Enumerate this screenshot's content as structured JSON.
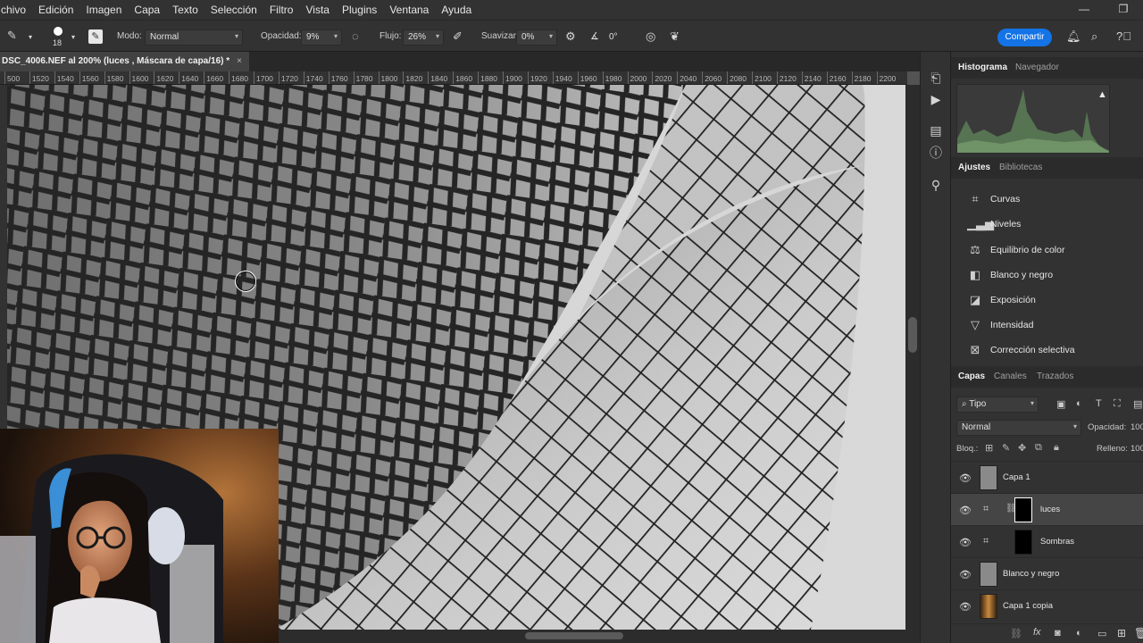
{
  "menu": [
    "chivo",
    "Edición",
    "Imagen",
    "Capa",
    "Texto",
    "Selección",
    "Filtro",
    "Vista",
    "Plugins",
    "Ventana",
    "Ayuda"
  ],
  "options": {
    "brush_size": "18",
    "mode_label": "Modo:",
    "mode_value": "Normal",
    "opacity_label": "Opacidad:",
    "opacity_value": "9%",
    "flow_label": "Flujo:",
    "flow_value": "26%",
    "smooth_label": "Suavizar:",
    "smooth_value": "0%",
    "angle_value": "0°",
    "share_label": "Compartir"
  },
  "document": {
    "tab_title": "DSC_4006.NEF al 200% (luces , Máscara de capa/16) *",
    "close_glyph": "×"
  },
  "ruler_ticks": [
    "500",
    "1520",
    "1540",
    "1560",
    "1580",
    "1600",
    "1620",
    "1640",
    "1660",
    "1680",
    "1700",
    "1720",
    "1740",
    "1760",
    "1780",
    "1800",
    "1820",
    "1840",
    "1860",
    "1880",
    "1900",
    "1920",
    "1940",
    "1960",
    "1980",
    "2000",
    "2020",
    "2040",
    "2060",
    "2080",
    "2100",
    "2120",
    "2140",
    "2160",
    "2180",
    "2200"
  ],
  "panels": {
    "top_tabs": [
      "Histograma",
      "Navegador"
    ],
    "adjust_tabs": [
      "Ajustes",
      "Bibliotecas"
    ],
    "adjustments": [
      {
        "icon": "curves-icon",
        "label": "Curvas"
      },
      {
        "icon": "levels-icon",
        "label": "Niveles"
      },
      {
        "icon": "color-balance-icon",
        "label": "Equilibrio de color"
      },
      {
        "icon": "black-white-icon",
        "label": "Blanco y negro"
      },
      {
        "icon": "exposure-icon",
        "label": "Exposición"
      },
      {
        "icon": "vibrance-icon",
        "label": "Intensidad"
      },
      {
        "icon": "selective-color-icon",
        "label": "Corrección selectiva"
      }
    ],
    "layer_tabs": [
      "Capas",
      "Canales",
      "Trazados"
    ],
    "filter_kind": "Tipo",
    "blend_mode": "Normal",
    "opacity_label": "Opacidad:",
    "opacity_value": "100",
    "lock_label": "Bloq.:",
    "fill_label": "Relleno:",
    "fill_value": "100"
  },
  "layers": [
    {
      "name": "Capa 1",
      "type": "pixel",
      "selected": false
    },
    {
      "name": "luces",
      "type": "adjustment",
      "selected": true
    },
    {
      "name": "Sombras",
      "type": "adjustment",
      "selected": false
    },
    {
      "name": "Blanco y negro",
      "type": "pixel",
      "selected": false
    },
    {
      "name": "Capa 1 copia",
      "type": "photo",
      "selected": false
    }
  ],
  "colors": {
    "accent": "#1473e6",
    "panel_bg": "#323232",
    "app_bg": "#535353"
  }
}
